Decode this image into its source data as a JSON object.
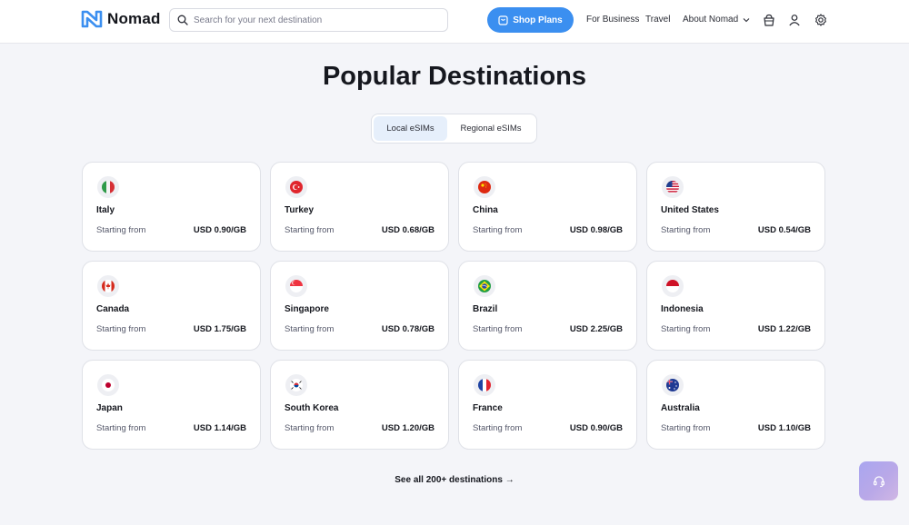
{
  "header": {
    "brand": "Nomad",
    "search_placeholder": "Search for your next destination",
    "shop_label": "Shop Plans",
    "nav_business": "For Business",
    "nav_travel": "Travel",
    "nav_about": "About Nomad"
  },
  "main": {
    "title": "Popular Destinations",
    "tabs": [
      {
        "label": "Local eSIMs",
        "active": true
      },
      {
        "label": "Regional eSIMs",
        "active": false
      }
    ],
    "starting_label": "Starting from",
    "cards": [
      {
        "country": "Italy",
        "price": "USD 0.90/GB",
        "flag": "italy-flag-icon"
      },
      {
        "country": "Turkey",
        "price": "USD 0.68/GB",
        "flag": "turkey-flag-icon"
      },
      {
        "country": "China",
        "price": "USD 0.98/GB",
        "flag": "china-flag-icon"
      },
      {
        "country": "United States",
        "price": "USD 0.54/GB",
        "flag": "us-flag-icon"
      },
      {
        "country": "Canada",
        "price": "USD 1.75/GB",
        "flag": "canada-flag-icon"
      },
      {
        "country": "Singapore",
        "price": "USD 0.78/GB",
        "flag": "singapore-flag-icon"
      },
      {
        "country": "Brazil",
        "price": "USD 2.25/GB",
        "flag": "brazil-flag-icon"
      },
      {
        "country": "Indonesia",
        "price": "USD 1.22/GB",
        "flag": "indonesia-flag-icon"
      },
      {
        "country": "Japan",
        "price": "USD 1.14/GB",
        "flag": "japan-flag-icon"
      },
      {
        "country": "South Korea",
        "price": "USD 1.20/GB",
        "flag": "south-korea-flag-icon"
      },
      {
        "country": "France",
        "price": "USD 0.90/GB",
        "flag": "france-flag-icon"
      },
      {
        "country": "Australia",
        "price": "USD 1.10/GB",
        "flag": "australia-flag-icon"
      }
    ],
    "see_all": "See all 200+ destinations →"
  },
  "colors": {
    "accent": "#3b8ff0",
    "brand_logo": "#3b8ff0",
    "background": "#f4f5f9"
  }
}
